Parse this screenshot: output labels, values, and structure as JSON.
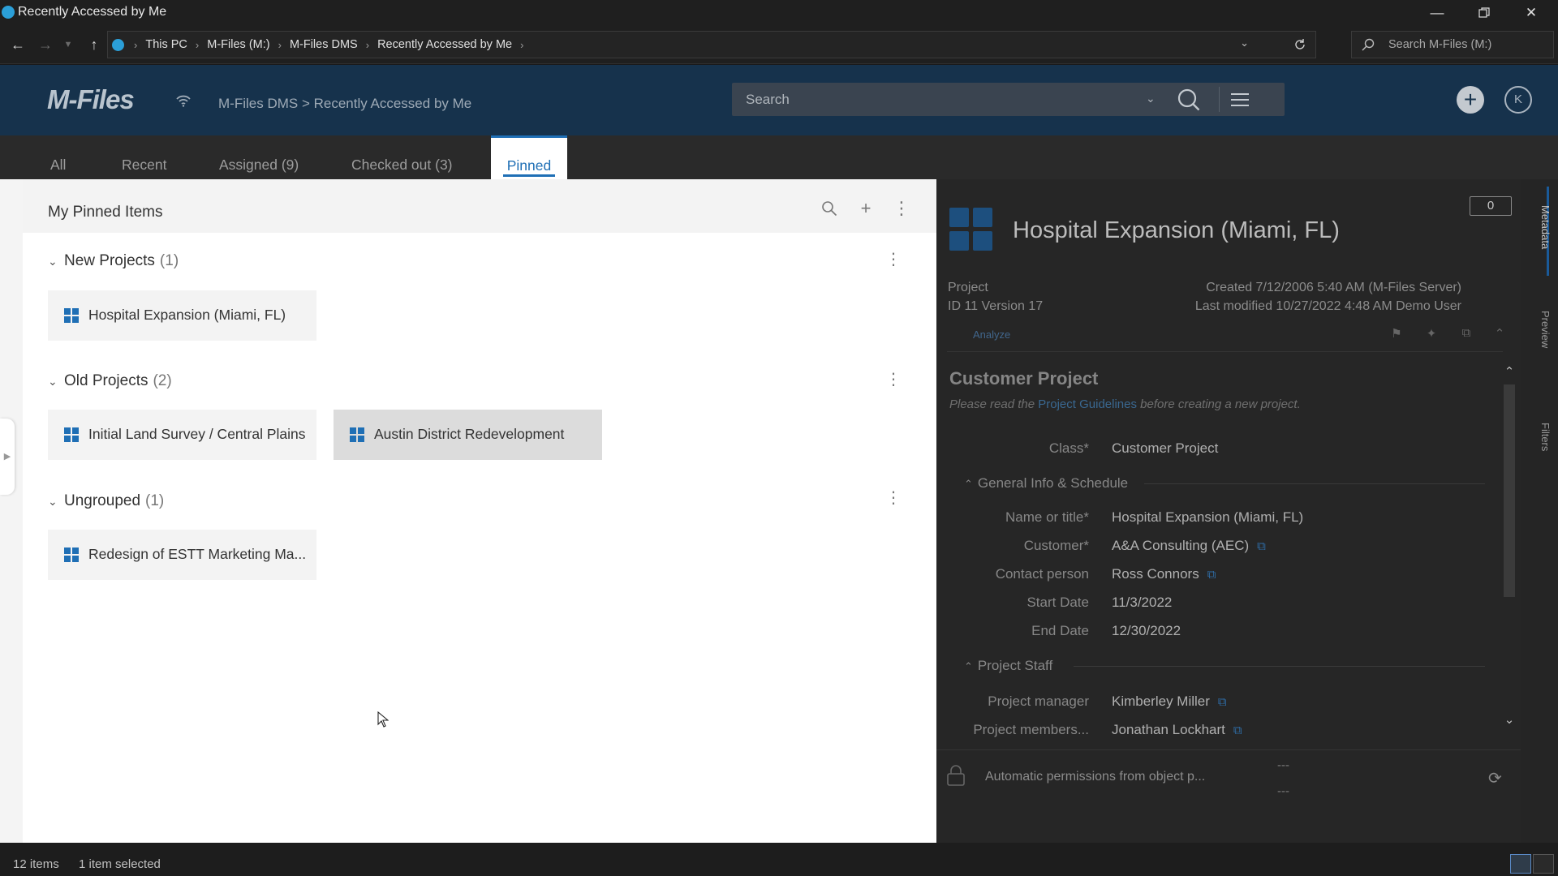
{
  "window": {
    "title": "Recently Accessed by Me",
    "minimize_icon": "minimize-icon",
    "maximize_icon": "restore-icon",
    "close_icon": "close-icon"
  },
  "explorer": {
    "breadcrumb": [
      "This PC",
      "M-Files (M:)",
      "M-Files DMS",
      "Recently Accessed by Me"
    ],
    "search_placeholder": "Search M-Files (M:)"
  },
  "mfiles": {
    "logo": "M-Files",
    "breadcrumb": "M-Files DMS > Recently Accessed by Me",
    "search_placeholder": "Search",
    "avatar_initial": "K",
    "accent_color": "#1f6fb5",
    "header_color": "#16324c"
  },
  "tabs": [
    {
      "label": "All",
      "active": false
    },
    {
      "label": "Recent",
      "active": false
    },
    {
      "label": "Assigned (9)",
      "active": false
    },
    {
      "label": "Checked out (3)",
      "active": false
    },
    {
      "label": "Pinned",
      "active": true
    }
  ],
  "pinned": {
    "title": "My Pinned Items",
    "groups": [
      {
        "name": "New Projects",
        "count": "(1)",
        "items": [
          {
            "label": "Hospital Expansion (Miami, FL)",
            "selected": false
          }
        ]
      },
      {
        "name": "Old Projects",
        "count": "(2)",
        "items": [
          {
            "label": "Initial Land Survey / Central Plains",
            "selected": false
          },
          {
            "label": "Austin District Redevelopment",
            "selected": true
          }
        ]
      },
      {
        "name": "Ungrouped",
        "count": "(1)",
        "items": [
          {
            "label": "Redesign of ESTT Marketing Ma...",
            "selected": false
          }
        ]
      }
    ]
  },
  "details": {
    "title": "Hospital Expansion (Miami, FL)",
    "comment_count": "0",
    "object_type": "Project",
    "id_version": "ID 11  Version 17",
    "created": "Created 7/12/2006 5:40 AM (M-Files Server)",
    "modified": "Last modified 10/27/2022 4:48 AM Demo User",
    "analyze": "Analyze",
    "card_title": "Customer Project",
    "guideline_before": "Please read the ",
    "guideline_link": "Project Guidelines",
    "guideline_after": " before creating a new project.",
    "class_label": "Class*",
    "class_value": "Customer Project",
    "section_general": "General Info & Schedule",
    "section_staff": "Project Staff",
    "properties": [
      {
        "label": "Name or title*",
        "value": "Hospital Expansion (Miami, FL)",
        "link": false
      },
      {
        "label": "Customer*",
        "value": "A&A Consulting (AEC)",
        "link": true
      },
      {
        "label": "Contact person",
        "value": "Ross Connors",
        "link": true
      },
      {
        "label": "Start Date",
        "value": "11/3/2022",
        "link": false
      },
      {
        "label": "End Date",
        "value": "12/30/2022",
        "link": false
      }
    ],
    "staff": [
      {
        "label": "Project manager",
        "value": "Kimberley Miller",
        "link": true
      },
      {
        "label": "Project members...",
        "value": "Jonathan Lockhart",
        "link": true
      }
    ],
    "permissions": "Automatic permissions from object p...",
    "perm_dash_1": "---",
    "perm_dash_2": "---"
  },
  "side_tabs": [
    "Metadata",
    "Preview",
    "Filters"
  ],
  "status": {
    "items": "12 items",
    "selected": "1 item selected"
  }
}
